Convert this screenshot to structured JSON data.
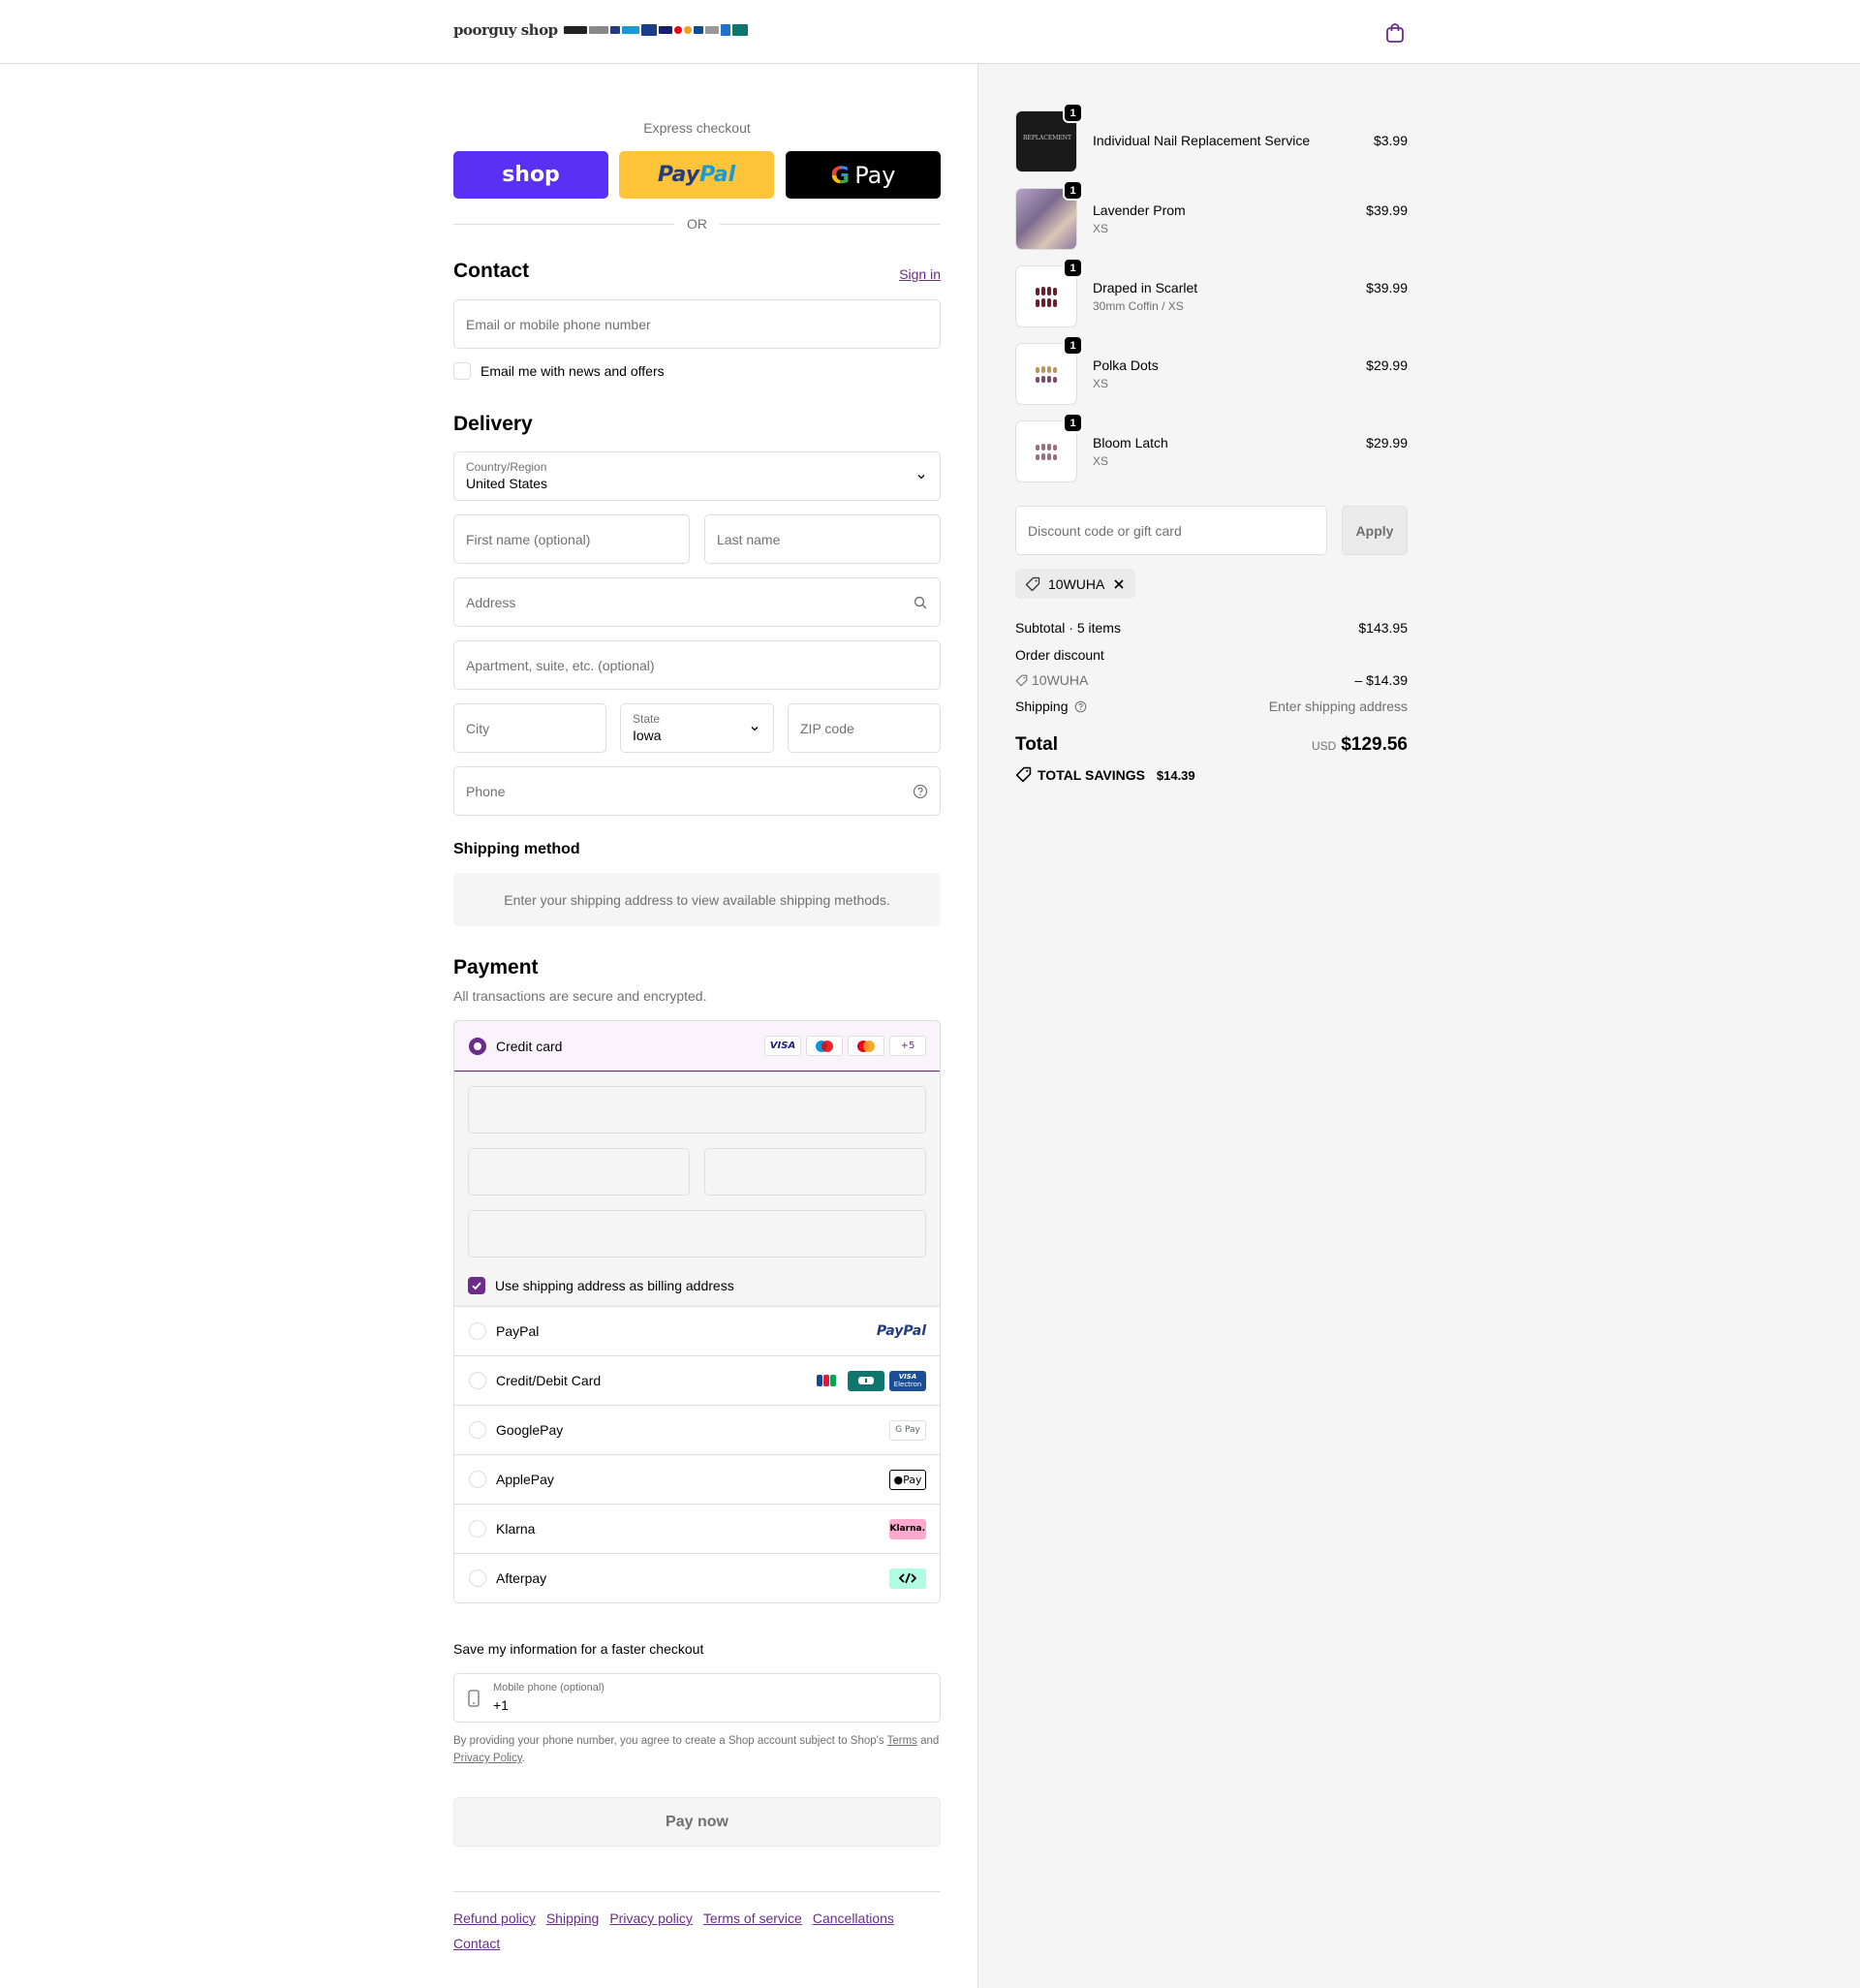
{
  "header": {
    "brand": "poorguy shop",
    "payment_strip": "Pay G Pay P PayPal VISA JCB",
    "cart_icon": "shopping-bag-icon"
  },
  "express": {
    "title": "Express checkout",
    "shop_label": "shop",
    "paypal_label_a": "Pay",
    "paypal_label_b": "Pal",
    "gpay_g": "G",
    "gpay_label": "Pay",
    "or": "OR"
  },
  "contact": {
    "title": "Contact",
    "sign_in": "Sign in",
    "email_placeholder": "Email or mobile phone number",
    "news_label": "Email me with news and offers",
    "news_checked": false
  },
  "delivery": {
    "title": "Delivery",
    "country_label": "Country/Region",
    "country_value": "United States",
    "first_name_placeholder": "First name (optional)",
    "last_name_placeholder": "Last name",
    "address_placeholder": "Address",
    "apartment_placeholder": "Apartment, suite, etc. (optional)",
    "city_placeholder": "City",
    "state_label": "State",
    "state_value": "Iowa",
    "zip_placeholder": "ZIP code",
    "phone_placeholder": "Phone"
  },
  "shipping_method": {
    "title": "Shipping method",
    "message": "Enter your shipping address to view available shipping methods."
  },
  "payment": {
    "title": "Payment",
    "subtitle": "All transactions are secure and encrypted.",
    "credit_card_label": "Credit card",
    "credit_card_logos": [
      "VISA",
      "maestro",
      "mastercard",
      "+5"
    ],
    "billing_label": "Use shipping address as billing address",
    "billing_checked": true,
    "options": [
      {
        "label": "PayPal",
        "logo": "PayPal"
      },
      {
        "label": "Credit/Debit Card",
        "logo": "JCB / UnionPay / VISA Electron"
      },
      {
        "label": "GooglePay",
        "logo": "G Pay"
      },
      {
        "label": "ApplePay",
        "logo": "Pay"
      },
      {
        "label": "Klarna",
        "logo": "Klarna."
      },
      {
        "label": "Afterpay",
        "logo": "afterpay-icon"
      }
    ],
    "logo_text": {
      "paypal": "PayPal",
      "visa": "VISA",
      "plus": "+5",
      "visa_electron_top": "VISA",
      "visa_electron_bottom": "Electron",
      "gpay": "G Pay",
      "applepay": "Pay",
      "klarna": "Klarna."
    }
  },
  "save_info": {
    "title": "Save my information for a faster checkout",
    "mobile_label": "Mobile phone (optional)",
    "mobile_value": "+1",
    "terms_prefix": "By providing your phone number, you agree to create a Shop account subject to Shop's",
    "terms_link": "Terms",
    "terms_and": "and",
    "privacy_link": "Privacy Policy",
    "terms_suffix": "."
  },
  "pay_now": "Pay now",
  "footer_links": [
    "Refund policy",
    "Shipping",
    "Privacy policy",
    "Terms of service",
    "Cancellations",
    "Contact"
  ],
  "summary": {
    "items": [
      {
        "name": "Individual Nail Replacement Service",
        "variant": "",
        "price": "$3.99",
        "qty": "1",
        "thumb_text": "REPLACEMENT"
      },
      {
        "name": "Lavender Prom",
        "variant": "XS",
        "price": "$39.99",
        "qty": "1"
      },
      {
        "name": "Draped in Scarlet",
        "variant": "30mm Coffin / XS",
        "price": "$39.99",
        "qty": "1"
      },
      {
        "name": "Polka Dots",
        "variant": "XS",
        "price": "$29.99",
        "qty": "1"
      },
      {
        "name": "Bloom Latch",
        "variant": "XS",
        "price": "$29.99",
        "qty": "1"
      }
    ],
    "discount_placeholder": "Discount code or gift card",
    "apply": "Apply",
    "applied_code": "10WUHA",
    "subtotal_label": "Subtotal · 5 items",
    "subtotal_value": "$143.95",
    "order_discount_label": "Order discount",
    "discount_code": "10WUHA",
    "discount_value": "– $14.39",
    "shipping_label": "Shipping",
    "shipping_value": "Enter shipping address",
    "total_label": "Total",
    "currency": "USD",
    "total_value": "$129.56",
    "savings_label": "TOTAL SAVINGS",
    "savings_value": "$14.39"
  },
  "colors": {
    "accent": "#6b2c8a",
    "shop_pay": "#5a31f4",
    "paypal_yellow": "#ffc439",
    "summary_bg": "#f5f5f5"
  }
}
